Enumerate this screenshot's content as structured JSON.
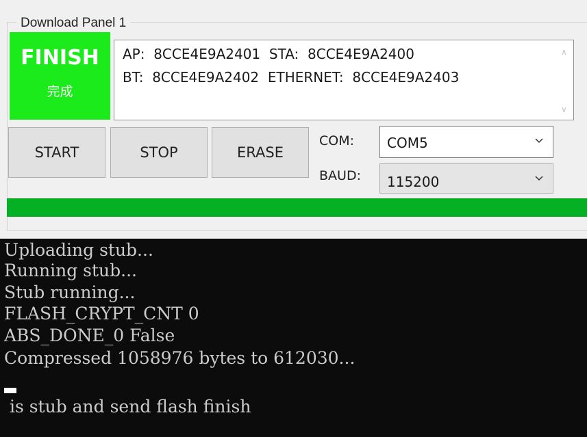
{
  "panel": {
    "title": "Download Panel 1",
    "status": {
      "main": "FINISH",
      "sub": "完成",
      "color": "#1bea1b"
    },
    "info": {
      "line1": "AP:  8CCE4E9A2401  STA:  8CCE4E9A2400",
      "line2": "BT:  8CCE4E9A2402  ETHERNET:  8CCE4E9A2403"
    },
    "buttons": {
      "start": "START",
      "stop": "STOP",
      "erase": "ERASE"
    },
    "com": {
      "label": "COM:",
      "value": "COM5"
    },
    "baud": {
      "label": "BAUD:",
      "value": "115200"
    },
    "progress": {
      "percent": 100,
      "color": "#06b025"
    }
  },
  "console": {
    "lines": [
      "Uploading stub...",
      "Running stub...",
      "Stub running...",
      "FLASH_CRYPT_CNT 0",
      "ABS_DONE_0 False",
      "Compressed 1058976 bytes to 612030...",
      " is stub and send flash finish"
    ]
  }
}
